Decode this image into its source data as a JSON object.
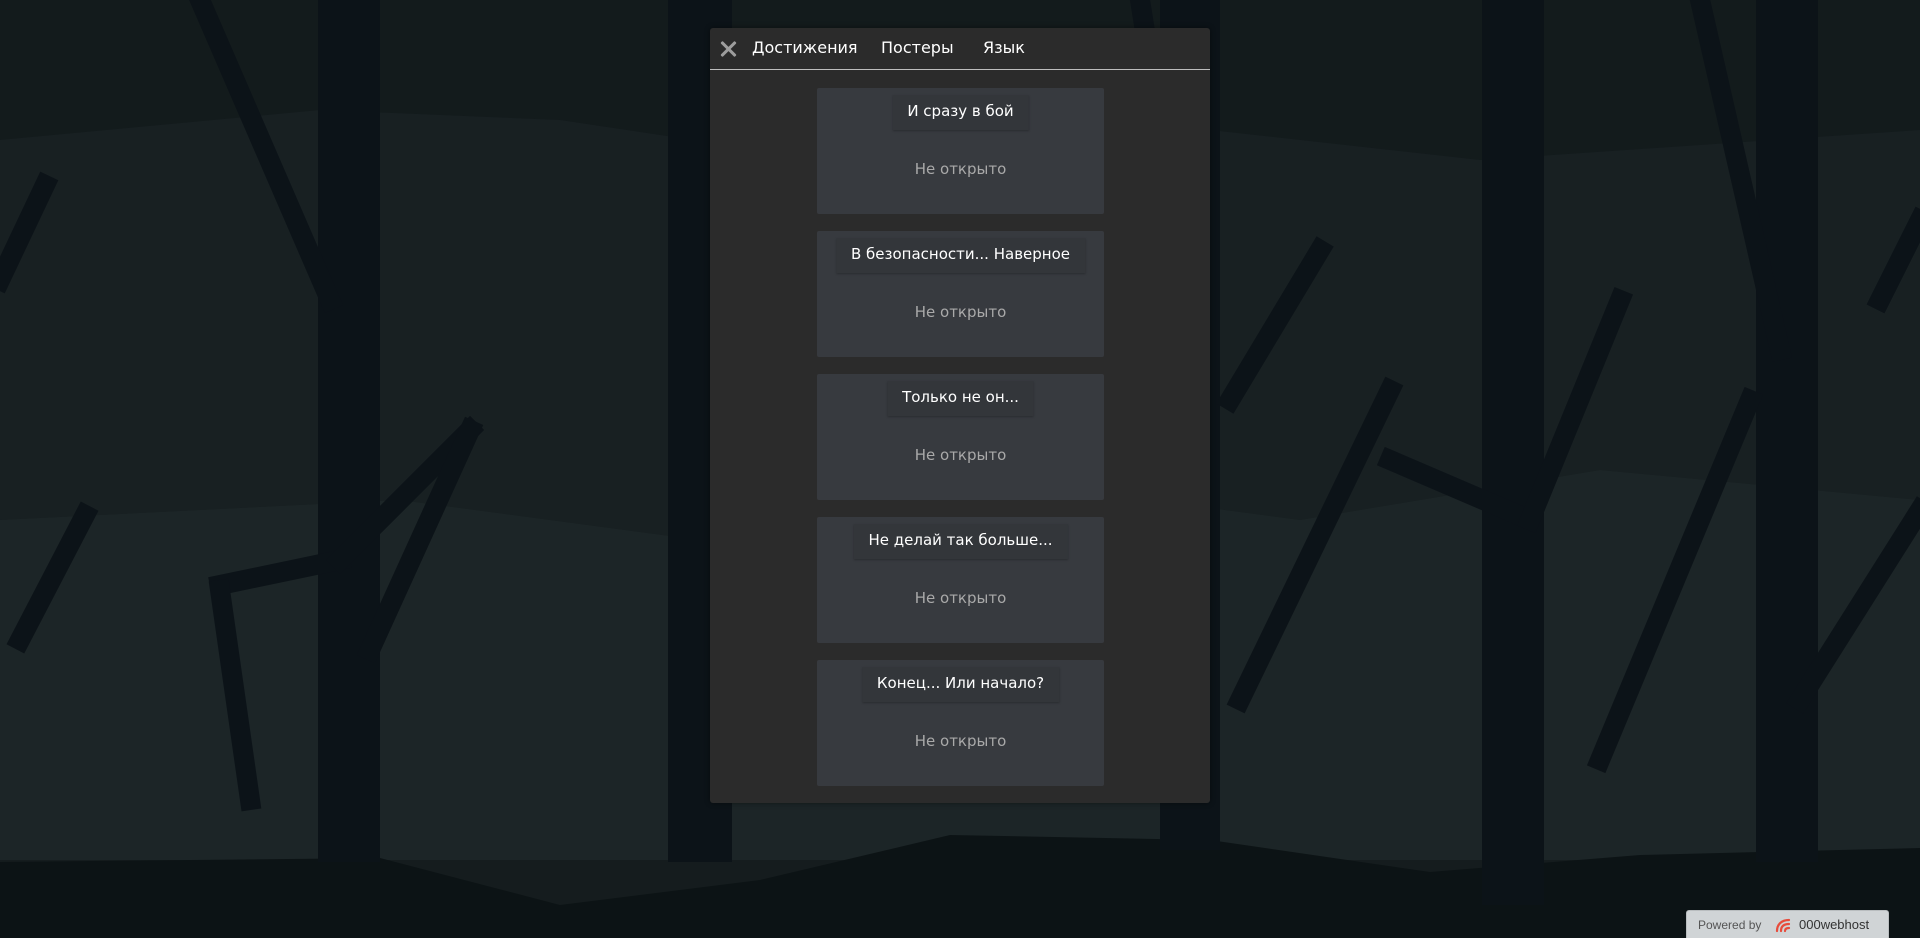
{
  "modal": {
    "tabs": {
      "achievements": "Достижения",
      "posters": "Постеры",
      "language": "Язык"
    },
    "achievements": [
      {
        "title": "И сразу в бой",
        "status": "Не открыто"
      },
      {
        "title": "В безопасности... Наверное",
        "status": "Не открыто"
      },
      {
        "title": "Только не он...",
        "status": "Не открыто"
      },
      {
        "title": "Не делай так больше...",
        "status": "Не открыто"
      },
      {
        "title": "Конец... Или начало?",
        "status": "Не открыто"
      }
    ]
  },
  "footer": {
    "powered_label": "Powered by",
    "host_name": "000webhost"
  },
  "colors": {
    "background": "#1b2527",
    "trees": "#101820",
    "modal": "#2b2b2b",
    "card": "#373a3f",
    "accent_logo": "#e74c3c"
  }
}
